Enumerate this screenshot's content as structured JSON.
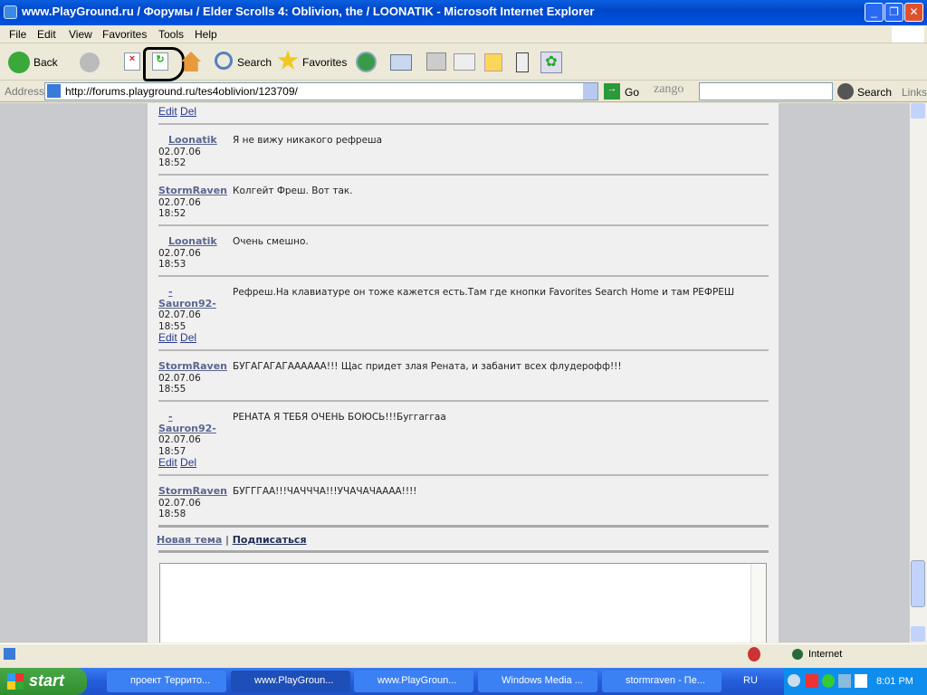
{
  "window": {
    "title": "www.PlayGround.ru / Форумы / Elder Scrolls 4: Oblivion, the / LOONATIK - Microsoft Internet Explorer",
    "min": "_",
    "restore": "❐",
    "close": "✕"
  },
  "menu": [
    "File",
    "Edit",
    "View",
    "Favorites",
    "Tools",
    "Help"
  ],
  "toolbar": {
    "back": "Back",
    "search": "Search",
    "favorites": "Favorites"
  },
  "address": {
    "label": "Address",
    "url": "http://forums.playground.ru/tes4oblivion/123709/",
    "go": "Go",
    "zango": "zango",
    "search": "Search",
    "links": "Links"
  },
  "posts": [
    {
      "user": "Loonatik",
      "date": "02.07.06",
      "time": "18:52",
      "text": "Я не вижу никакого рефреша"
    },
    {
      "user": "StormRaven",
      "date": "02.07.06",
      "time": "18:52",
      "text": "Колгейт Фреш. Вот так."
    },
    {
      "user": "Loonatik",
      "date": "02.07.06",
      "time": "18:53",
      "text": "Очень смешно."
    },
    {
      "user_line1": "-",
      "user": "Sauron92-",
      "date": "02.07.06",
      "time": "18:55",
      "text": "Рефреш.На клавиатуре он тоже кажется есть.Там где кнопки Favorites Search Home и там РЕФРЕШ",
      "edit": "Edit",
      "del": "Del"
    },
    {
      "user": "StormRaven",
      "date": "02.07.06",
      "time": "18:55",
      "text": "БУГАГАГАГАААААА!!! Щас придет злая Рената, и забанит всех флудерофф!!!"
    },
    {
      "user_line1": "-",
      "user": "Sauron92-",
      "date": "02.07.06",
      "time": "18:57",
      "text": "РЕНАТА Я ТЕБЯ ОЧЕНЬ БОЮСЬ!!!Буггаггаа",
      "edit": "Edit",
      "del": "Del"
    },
    {
      "user": "StormRaven",
      "date": "02.07.06",
      "time": "18:58",
      "text": "БУГГГАА!!!ЧАЧЧЧА!!!УЧАЧАЧАААА!!!!"
    }
  ],
  "top_links": {
    "edit": "Edit",
    "del": "Del"
  },
  "footer": {
    "new_topic": "Новая тема",
    "sep": "|",
    "subscribe": "Подписаться"
  },
  "status": {
    "zone": "Internet"
  },
  "taskbar": {
    "start": "start",
    "tasks": [
      "проект Террито...",
      "www.PlayGroun...",
      "www.PlayGroun...",
      "Windows Media ...",
      "stormraven - Пе..."
    ],
    "lang": "RU",
    "clock": "8:01 PM"
  }
}
